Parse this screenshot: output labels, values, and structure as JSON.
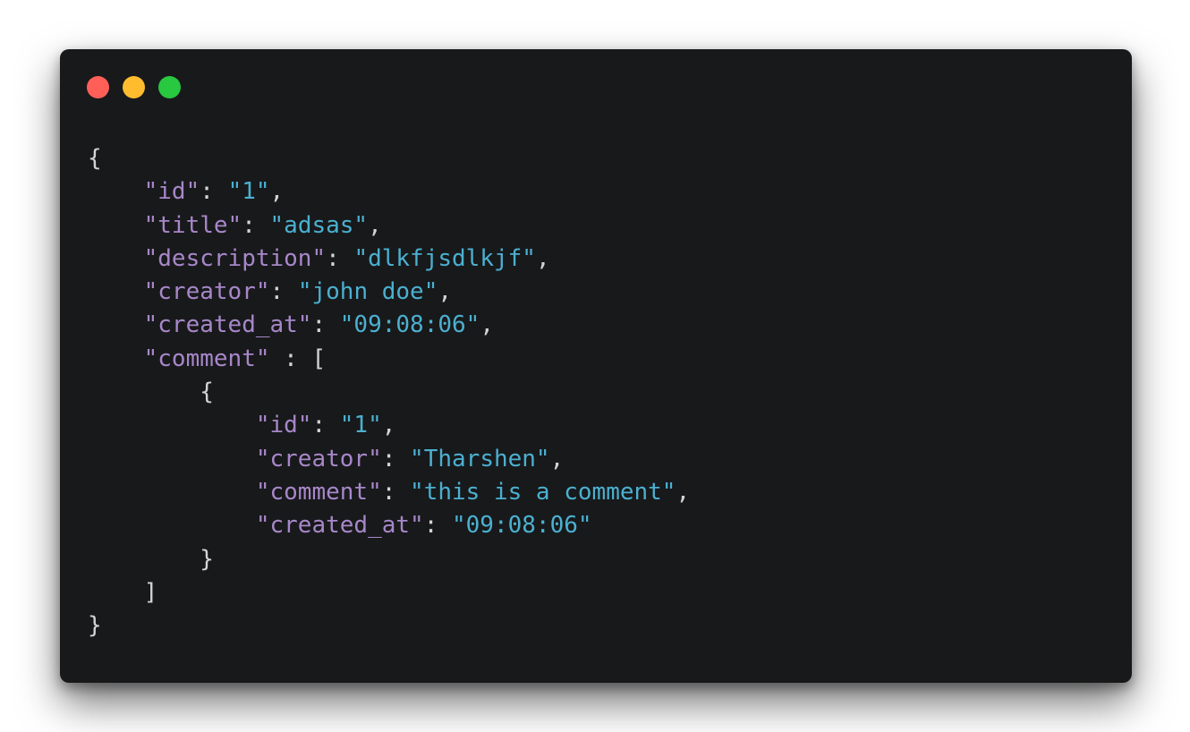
{
  "window": {
    "controls": [
      {
        "name": "close",
        "color": "#ff5f57"
      },
      {
        "name": "minimize",
        "color": "#febc2e"
      },
      {
        "name": "maximize",
        "color": "#28c840"
      }
    ]
  },
  "code": {
    "open_brace": "{",
    "close_brace": "}",
    "fields": [
      {
        "key": "\"id\"",
        "sep": ": ",
        "value": "\"1\"",
        "trail": ","
      },
      {
        "key": "\"title\"",
        "sep": ": ",
        "value": "\"adsas\"",
        "trail": ","
      },
      {
        "key": "\"description\"",
        "sep": ": ",
        "value": "\"dlkfjsdlkjf\"",
        "trail": ","
      },
      {
        "key": "\"creator\"",
        "sep": ": ",
        "value": "\"john doe\"",
        "trail": ","
      },
      {
        "key": "\"created_at\"",
        "sep": ": ",
        "value": "\"09:08:06\"",
        "trail": ","
      }
    ],
    "comment_key": "\"comment\"",
    "comment_sep": " : [",
    "inner_open": "{",
    "inner_fields": [
      {
        "key": "\"id\"",
        "sep": ": ",
        "value": "\"1\"",
        "trail": ","
      },
      {
        "key": "\"creator\"",
        "sep": ": ",
        "value": "\"Tharshen\"",
        "trail": ","
      },
      {
        "key": "\"comment\"",
        "sep": ": ",
        "value": "\"this is a comment\"",
        "trail": ","
      },
      {
        "key": "\"created_at\"",
        "sep": ": ",
        "value": "\"09:08:06\"",
        "trail": ""
      }
    ],
    "inner_close": "}",
    "array_close": "]",
    "colors": {
      "background": "#18191b",
      "key": "#a787c9",
      "string": "#4bb0d0",
      "punctuation": "#d4d4d4"
    }
  }
}
